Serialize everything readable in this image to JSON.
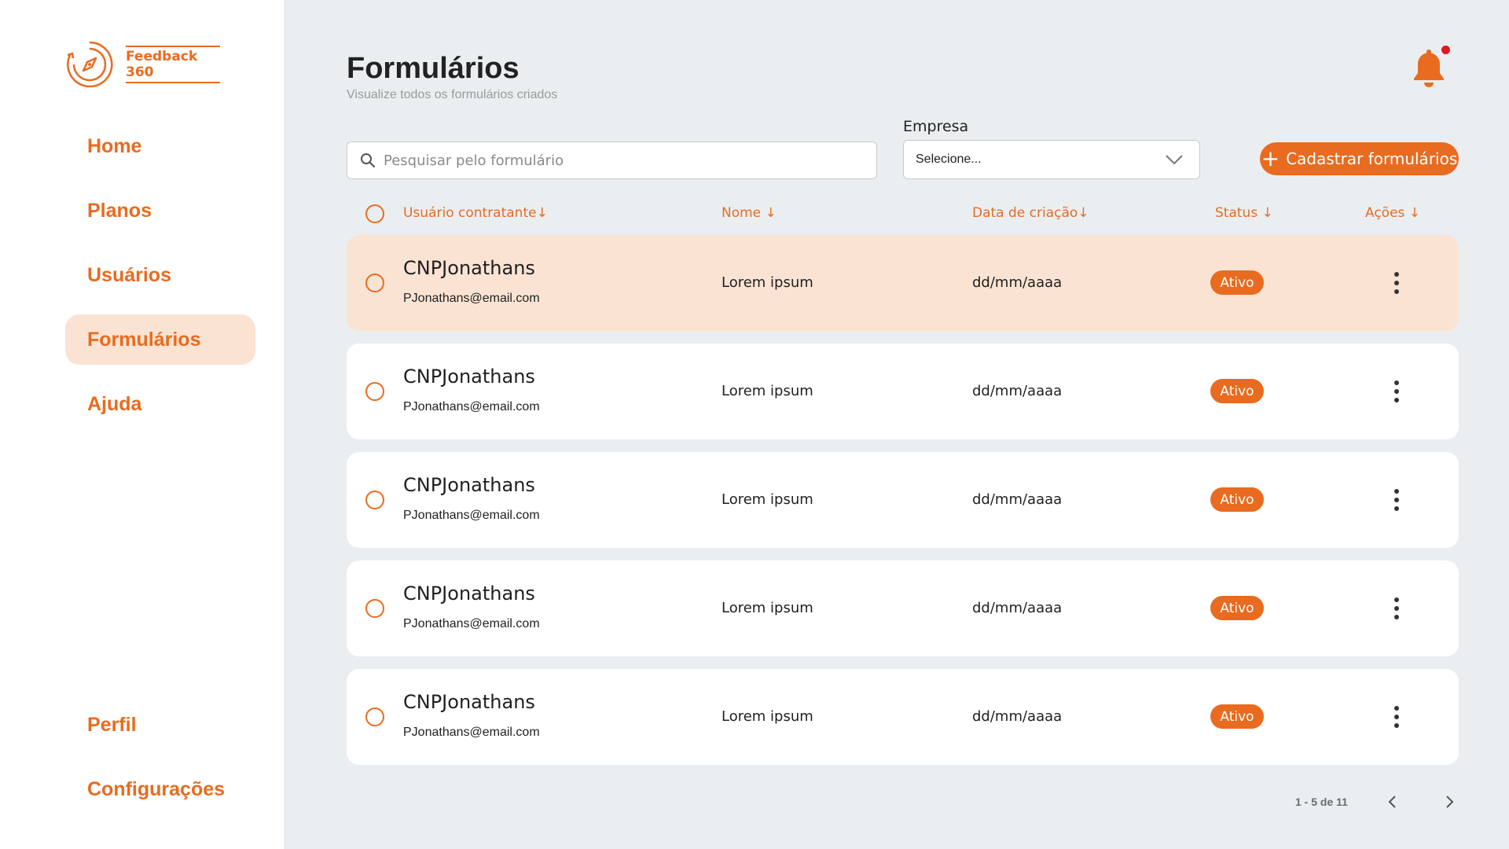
{
  "brand": {
    "logo_text": "Feedback 360",
    "accent": "#e96b1f"
  },
  "sidebar": {
    "items": [
      {
        "label": "Home"
      },
      {
        "label": "Planos"
      },
      {
        "label": "Usuários"
      },
      {
        "label": "Formulários",
        "active": true
      },
      {
        "label": "Ajuda"
      }
    ],
    "bottom_items": [
      {
        "label": "Perfil"
      },
      {
        "label": "Configurações"
      }
    ]
  },
  "header": {
    "title": "Formulários",
    "subtitle": "Visualize todos os formulários criados",
    "notification_icon": "bell-icon",
    "has_unread": true
  },
  "filters": {
    "search_placeholder": "Pesquisar pelo formulário",
    "search_value": "",
    "empresa_label": "Empresa",
    "empresa_selected": "Selecione...",
    "add_button_label": "Cadastrar formulários"
  },
  "table": {
    "columns": [
      {
        "label": "Usuário contratante↓"
      },
      {
        "label": "Nome ↓"
      },
      {
        "label": "Data de criação↓"
      },
      {
        "label": "Status ↓"
      },
      {
        "label": "Ações ↓"
      }
    ],
    "rows": [
      {
        "name": "CNPJonathans",
        "email": "PJonathans@email.com",
        "nome": "Lorem ipsum",
        "date": "dd/mm/aaaa",
        "status": "Ativo",
        "selected": true
      },
      {
        "name": "CNPJonathans",
        "email": "PJonathans@email.com",
        "nome": "Lorem ipsum",
        "date": "dd/mm/aaaa",
        "status": "Ativo",
        "selected": false
      },
      {
        "name": "CNPJonathans",
        "email": "PJonathans@email.com",
        "nome": "Lorem ipsum",
        "date": "dd/mm/aaaa",
        "status": "Ativo",
        "selected": false
      },
      {
        "name": "CNPJonathans",
        "email": "PJonathans@email.com",
        "nome": "Lorem ipsum",
        "date": "dd/mm/aaaa",
        "status": "Ativo",
        "selected": false
      },
      {
        "name": "CNPJonathans",
        "email": "PJonathans@email.com",
        "nome": "Lorem ipsum",
        "date": "dd/mm/aaaa",
        "status": "Ativo",
        "selected": false
      }
    ]
  },
  "pagination": {
    "text": "1 - 5 de 11"
  }
}
